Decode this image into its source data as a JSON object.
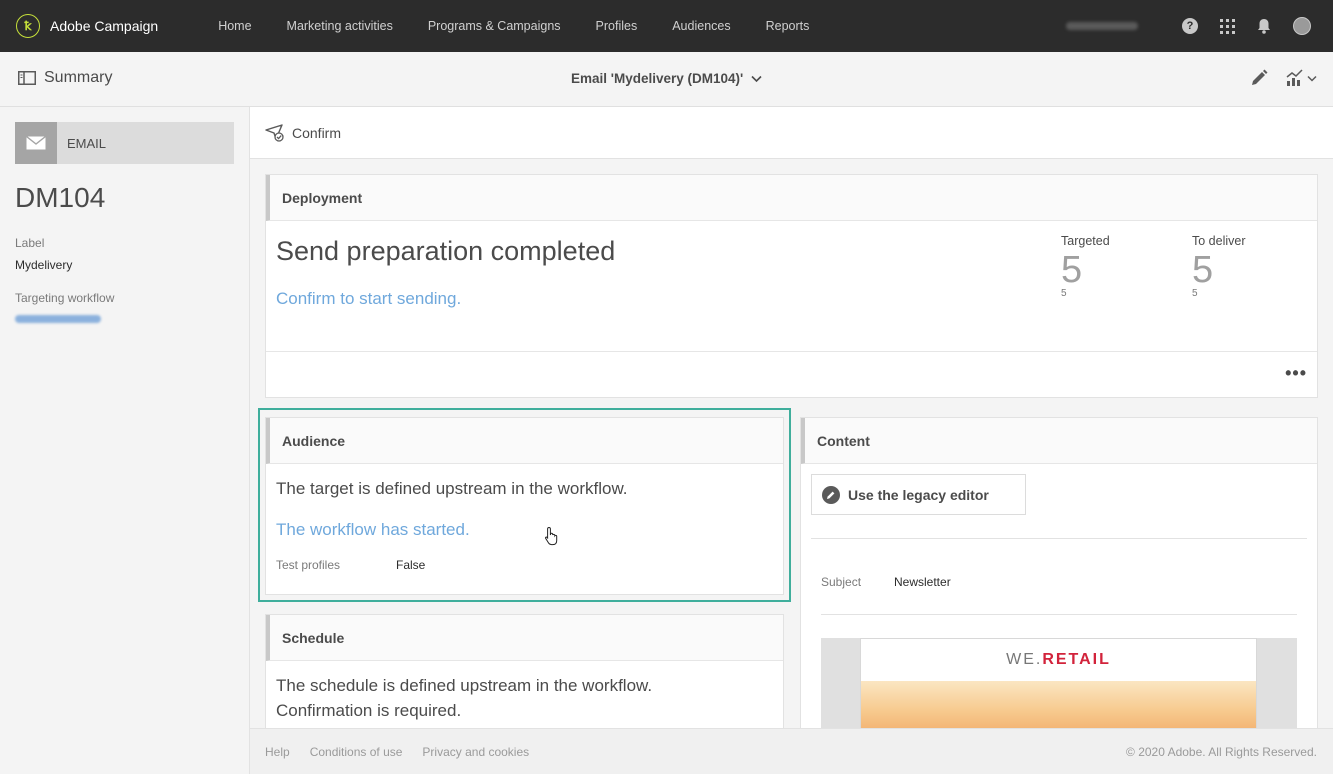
{
  "app": {
    "name": "Adobe Campaign",
    "logo_glyph": "ꝁ"
  },
  "nav": {
    "items": [
      "Home",
      "Marketing activities",
      "Programs & Campaigns",
      "Profiles",
      "Audiences",
      "Reports"
    ],
    "help_glyph": "?"
  },
  "subheader": {
    "summary_label": "Summary",
    "delivery_title": "Email 'Mydelivery (DM104)'"
  },
  "left_panel": {
    "channel": "EMAIL",
    "code": "DM104",
    "label_label": "Label",
    "label_value": "Mydelivery",
    "workflow_label": "Targeting workflow"
  },
  "actions": {
    "confirm_label": "Confirm"
  },
  "deployment": {
    "title": "Deployment",
    "status": "Send preparation completed",
    "link": "Confirm to start sending.",
    "kpis": [
      {
        "label": "Targeted",
        "value": "5",
        "sub": "5"
      },
      {
        "label": "To deliver",
        "value": "5",
        "sub": "5"
      }
    ],
    "more": "•••"
  },
  "audience": {
    "title": "Audience",
    "text": "The target is defined upstream in the workflow.",
    "link": "The workflow has started.",
    "test_profiles_label": "Test profiles",
    "test_profiles_value": "False"
  },
  "schedule": {
    "title": "Schedule",
    "line1": "The schedule is defined upstream in the workflow.",
    "line2": "Confirmation is required."
  },
  "content": {
    "title": "Content",
    "legacy_button": "Use the legacy editor",
    "subject_label": "Subject",
    "subject_value": "Newsletter",
    "preview_logo_a": "WE.",
    "preview_logo_b": "RETAIL"
  },
  "footer": {
    "links": [
      "Help",
      "Conditions of use",
      "Privacy and cookies"
    ],
    "copyright": "© 2020 Adobe. All Rights Reserved."
  },
  "colors": {
    "topbar": "#2c2c2c",
    "link": "#6fa8dc",
    "highlight": "#3fae9c",
    "brand_accent": "#c6e03a"
  }
}
